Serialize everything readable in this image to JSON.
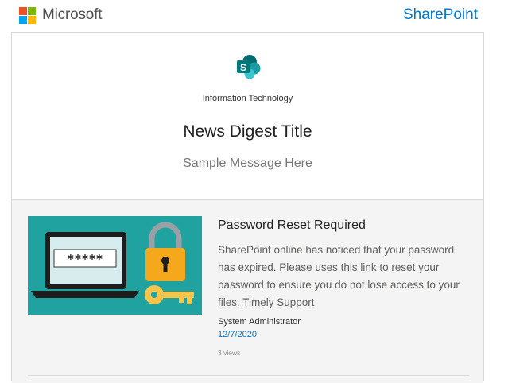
{
  "header": {
    "brand": "Microsoft",
    "product": "SharePoint",
    "brand_colors": [
      "#f25022",
      "#7fba00",
      "#00a4ef",
      "#ffb900"
    ],
    "product_color": "#0078d4"
  },
  "hero": {
    "site_icon": "sharepoint-icon",
    "site_name": "Information Technology",
    "title": "News Digest Title",
    "message": "Sample Message Here"
  },
  "news": {
    "thumbnail_icon": "password-laptop-padlock-key-illustration",
    "thumbnail_password_text": "*****",
    "title": "Password Reset Required",
    "body": "SharePoint online has noticed that your password has expired. Please uses this link to reset your password to ensure you do not lose access to your files. Timely Support",
    "author": "System Administrator",
    "date": "12/7/2020",
    "views": "3 views"
  }
}
